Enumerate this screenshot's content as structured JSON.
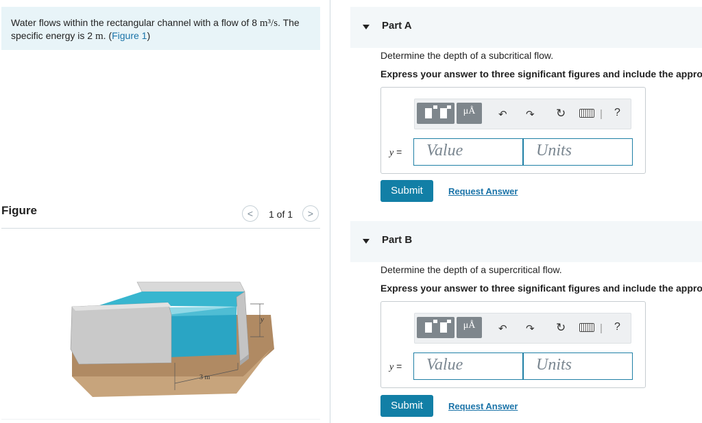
{
  "problem": {
    "text_before": "Water flows within the rectangular channel with a flow of 8 ",
    "flow_unit": "m³/s",
    "text_mid": ". The specific energy is 2 ",
    "energy_unit": "m",
    "text_after": ". (",
    "figure_link": "Figure 1",
    "close_paren": ")"
  },
  "figure": {
    "header": "Figure",
    "prev": "<",
    "next": ">",
    "count": "1 of 1",
    "dim_y": "y",
    "dim_width": "3 m"
  },
  "parts": [
    {
      "title": "Part A",
      "question": "Determine the depth of a subcritical flow.",
      "instruction": "Express your answer to three significant figures and include the appropriate units.",
      "var_label": "y",
      "eq": " =",
      "value_placeholder": "Value",
      "units_placeholder": "Units",
      "submit": "Submit",
      "request": "Request Answer"
    },
    {
      "title": "Part B",
      "question": "Determine the depth of a supercritical flow.",
      "instruction": "Express your answer to three significant figures and include the appropriate units.",
      "var_label": "y",
      "eq": " =",
      "value_placeholder": "Value",
      "units_placeholder": "Units",
      "submit": "Submit",
      "request": "Request Answer"
    }
  ],
  "toolbar": {
    "units_glyph": "μÅ",
    "help": "?",
    "separator": "|"
  }
}
